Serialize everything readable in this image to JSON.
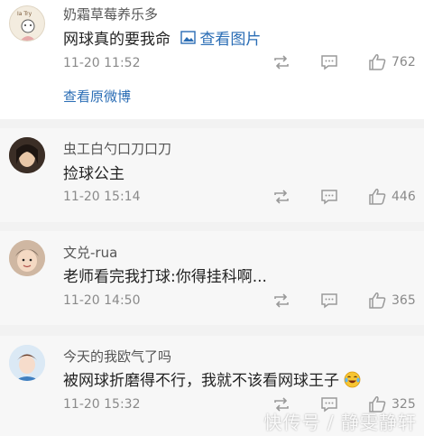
{
  "comments": [
    {
      "username": "奶霜草莓养乐多",
      "text": "网球真的要我命",
      "image_link": "查看图片",
      "time": "11-20 11:52",
      "likes": "762",
      "view_original": "查看原微博"
    },
    {
      "username": "虫工白勺口刀口刀",
      "text": "捡球公主",
      "time": "11-20 15:14",
      "likes": "446"
    },
    {
      "username": "文兑-rua",
      "text": "老师看完我打球:你得挂科啊...",
      "time": "11-20 14:50",
      "likes": "365"
    },
    {
      "username": "今天的我欧气了吗",
      "text": "被网球折磨得不行，我就不该看网球王子",
      "time": "11-20 15:32",
      "likes": "325"
    }
  ],
  "watermark": "快传号 / 静雯静轩",
  "icons": {
    "repost": "repost-icon",
    "comment": "comment-icon",
    "like": "thumbs-up-icon",
    "image": "image-icon",
    "emoji": "laughing-tears-emoji"
  },
  "colors": {
    "link": "#2a6db5",
    "muted": "#8a8a8a",
    "comment_bg": "#f7f7f7"
  }
}
